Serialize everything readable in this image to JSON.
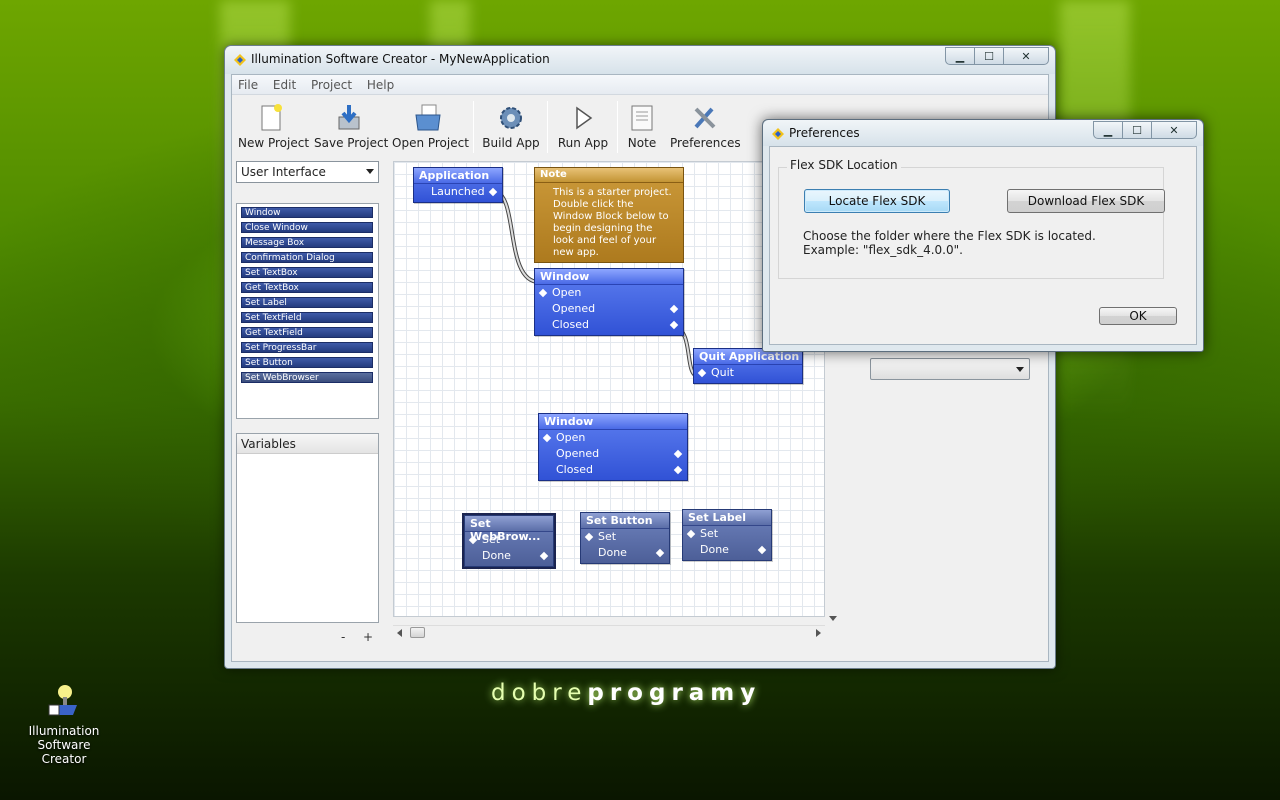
{
  "window": {
    "title": "Illumination Software Creator - MyNewApplication",
    "controls": {
      "minimize": "▁",
      "maximize": "☐",
      "close": "✕"
    }
  },
  "menu": [
    "File",
    "Edit",
    "Project",
    "Help"
  ],
  "toolbar": [
    {
      "label": "New Project",
      "icon": "new-project-icon"
    },
    {
      "label": "Save Project",
      "icon": "save-project-icon"
    },
    {
      "label": "Open Project",
      "icon": "open-project-icon"
    },
    {
      "label": "Build App",
      "icon": "gear-icon"
    },
    {
      "label": "Run App",
      "icon": "play-icon"
    },
    {
      "label": "Note",
      "icon": "note-icon"
    },
    {
      "label": "Preferences",
      "icon": "tools-icon"
    }
  ],
  "category_select": "User Interface",
  "blocks": [
    "Window",
    "Close Window",
    "Message Box",
    "Confirmation Dialog",
    "Set TextBox",
    "Get TextBox",
    "Set Label",
    "Set TextField",
    "Get TextField",
    "Set ProgressBar",
    "Set Button",
    "Set WebBrowser"
  ],
  "variables_header": "Variables",
  "pm": {
    "minus": "-",
    "plus": "+"
  },
  "canvas": {
    "application": {
      "title": "Application",
      "launched": "Launched"
    },
    "note": {
      "title": "Note",
      "text": "This is a starter project.  Double click the Window Block below to begin designing the look and feel of your new app."
    },
    "window1": {
      "title": "Window",
      "open": "Open",
      "opened": "Opened",
      "closed": "Closed"
    },
    "quit": {
      "title": "Quit Application",
      "quit": "Quit"
    },
    "window2": {
      "title": "Window",
      "open": "Open",
      "opened": "Opened",
      "closed": "Closed"
    },
    "set_webbrowser": {
      "title": "Set WebBrow...",
      "set": "Set",
      "done": "Done"
    },
    "set_button": {
      "title": "Set Button",
      "set": "Set",
      "done": "Done"
    },
    "set_label": {
      "title": "Set Label",
      "set": "Set",
      "done": "Done"
    }
  },
  "dialog": {
    "title": "Preferences",
    "group_label": "Flex SDK Location",
    "locate_button": "Locate Flex SDK",
    "download_button": "Download Flex SDK",
    "help_text": "Choose the folder where the Flex SDK is located.  Example: \"flex_sdk_4.0.0\".",
    "ok_button": "OK",
    "controls": {
      "minimize": "▁",
      "maximize": "☐",
      "close": "✕"
    }
  },
  "watermark": {
    "light": "dobre",
    "bold": "programy"
  },
  "desktop_icon": {
    "line1": "Illumination",
    "line2": "Software Creator"
  },
  "colors": {
    "block_blue": "#3152d6",
    "note_gold": "#ad7a1e",
    "desktop_green": "#4f8a00"
  }
}
